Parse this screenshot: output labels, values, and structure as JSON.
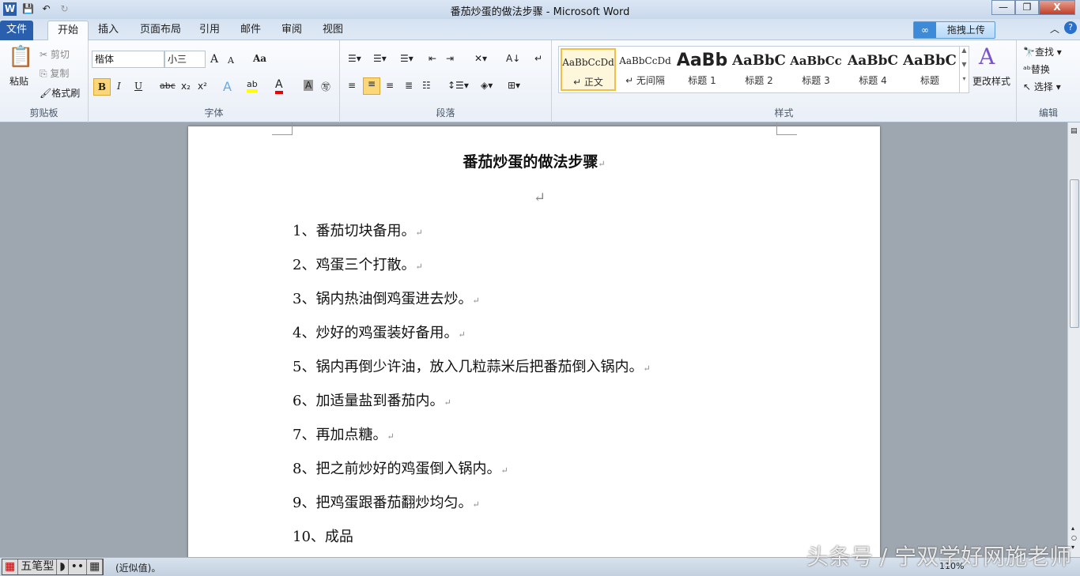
{
  "window": {
    "title": "番茄炒蛋的做法步骤 - Microsoft Word",
    "app_icon": "W",
    "minimize": "—",
    "restore": "❐",
    "close": "X"
  },
  "qat": {
    "save_icon": "save-icon",
    "undo_icon": "undo-icon",
    "redo_icon": "redo-icon"
  },
  "tabs": [
    "文件",
    "开始",
    "插入",
    "页面布局",
    "引用",
    "邮件",
    "审阅",
    "视图"
  ],
  "upload_label": "拖拽上传",
  "clipboard": {
    "paste": "粘贴",
    "cut": "剪切",
    "copy": "复制",
    "format_painter": "格式刷",
    "label": "剪贴板"
  },
  "font": {
    "name": "楷体",
    "size": "小三",
    "label": "字体",
    "bold": "B",
    "italic": "I",
    "underline": "U",
    "strike": "abc",
    "sub": "x₂",
    "sup": "x²",
    "grow": "A",
    "shrink": "A",
    "case": "Aa"
  },
  "paragraph": {
    "label": "段落"
  },
  "styles": {
    "label": "样式",
    "items": [
      {
        "preview": "AaBbCcDd",
        "name": "↵ 正文"
      },
      {
        "preview": "AaBbCcDd",
        "name": "↵ 无间隔"
      },
      {
        "preview": "AaBb",
        "name": "标题 1"
      },
      {
        "preview": "AaBbC",
        "name": "标题 2"
      },
      {
        "preview": "AaBbCc",
        "name": "标题 3"
      },
      {
        "preview": "AaBbC",
        "name": "标题 4"
      },
      {
        "preview": "AaBbC",
        "name": "标题"
      }
    ],
    "change": "更改样式"
  },
  "editing": {
    "label": "编辑",
    "find": "查找",
    "replace": "替换",
    "select": "选择"
  },
  "document": {
    "title": "番茄炒蛋的做法步骤",
    "para_mark": "↵",
    "lines": [
      "1、番茄切块备用。",
      "2、鸡蛋三个打散。",
      "3、锅内热油倒鸡蛋进去炒。",
      "4、炒好的鸡蛋装好备用。",
      "5、锅内再倒少许油，放入几粒蒜米后把番茄倒入锅内。",
      "6、加适量盐到番茄内。",
      "7、再加点糖。",
      "8、把之前炒好的鸡蛋倒入锅内。",
      "9、把鸡蛋跟番茄翻炒均匀。",
      "10、成品"
    ]
  },
  "status": {
    "ime": "五笔型",
    "text": "(近似值)。",
    "zoom": "110%"
  },
  "watermark": "头条号 / 宁双学好网施老师"
}
